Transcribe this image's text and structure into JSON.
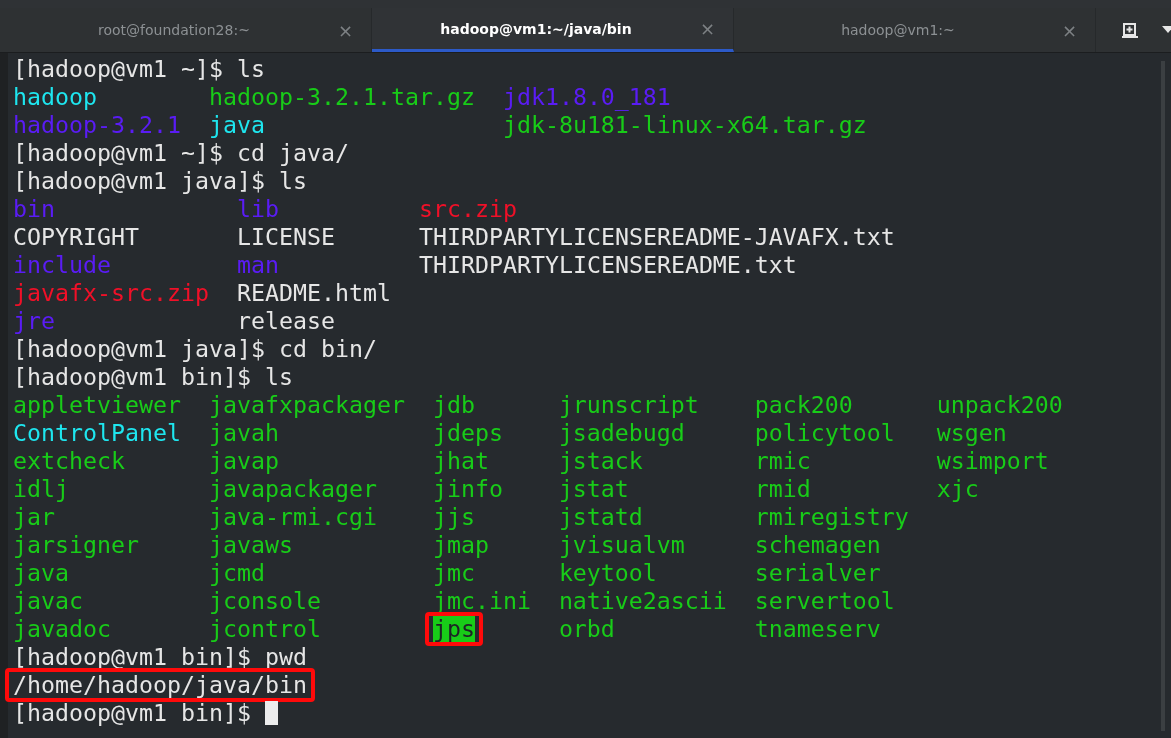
{
  "tabs": [
    {
      "title": "root@foundation28:~",
      "selected": false
    },
    {
      "title": "hadoop@vm1:~/java/bin",
      "selected": true
    },
    {
      "title": "hadoop@vm1:~",
      "selected": false
    }
  ],
  "close_glyph": "×",
  "terminal": {
    "lines": [
      {
        "kind": "command",
        "text": "[hadoop@vm1 ~]$ ls"
      },
      {
        "kind": "listing",
        "columns": [
          [
            {
              "name": "hadoop",
              "color": "#1ee6ef",
              "highlighted": false,
              "boxed": false
            },
            {
              "name": "hadoop-3.2.1",
              "color": "#5a1cf4",
              "highlighted": false,
              "boxed": false
            }
          ],
          [
            {
              "name": "hadoop-3.2.1.tar.gz",
              "color": "#18cc18",
              "highlighted": false,
              "boxed": false
            },
            {
              "name": "java",
              "color": "#1ee6ef",
              "highlighted": false,
              "boxed": false
            }
          ],
          [
            {
              "name": "jdk1.8.0_181",
              "color": "#5a1cf4",
              "highlighted": false,
              "boxed": false
            },
            {
              "name": "jdk-8u181-linux-x64.tar.gz",
              "color": "#18cc18",
              "highlighted": false,
              "boxed": false
            }
          ]
        ]
      },
      {
        "kind": "command",
        "text": "[hadoop@vm1 ~]$ cd java/"
      },
      {
        "kind": "command",
        "text": "[hadoop@vm1 java]$ ls"
      },
      {
        "kind": "listing",
        "columns": [
          [
            {
              "name": "bin",
              "color": "#5a1cf4",
              "highlighted": false,
              "boxed": false
            },
            {
              "name": "COPYRIGHT",
              "color": "#e6e6e6",
              "highlighted": false,
              "boxed": false
            },
            {
              "name": "include",
              "color": "#5a1cf4",
              "highlighted": false,
              "boxed": false
            },
            {
              "name": "javafx-src.zip",
              "color": "#f01028",
              "highlighted": false,
              "boxed": false
            },
            {
              "name": "jre",
              "color": "#5a1cf4",
              "highlighted": false,
              "boxed": false
            }
          ],
          [
            {
              "name": "lib",
              "color": "#5a1cf4",
              "highlighted": false,
              "boxed": false
            },
            {
              "name": "LICENSE",
              "color": "#e6e6e6",
              "highlighted": false,
              "boxed": false
            },
            {
              "name": "man",
              "color": "#5a1cf4",
              "highlighted": false,
              "boxed": false
            },
            {
              "name": "README.html",
              "color": "#e6e6e6",
              "highlighted": false,
              "boxed": false
            },
            {
              "name": "release",
              "color": "#e6e6e6",
              "highlighted": false,
              "boxed": false
            }
          ],
          [
            {
              "name": "src.zip",
              "color": "#f01028",
              "highlighted": false,
              "boxed": false
            },
            {
              "name": "THIRDPARTYLICENSEREADME-JAVAFX.txt",
              "color": "#e6e6e6",
              "highlighted": false,
              "boxed": false
            },
            {
              "name": "THIRDPARTYLICENSEREADME.txt",
              "color": "#e6e6e6",
              "highlighted": false,
              "boxed": false
            }
          ]
        ]
      },
      {
        "kind": "command",
        "text": "[hadoop@vm1 java]$ cd bin/"
      },
      {
        "kind": "command",
        "text": "[hadoop@vm1 bin]$ ls"
      },
      {
        "kind": "listing",
        "columns": [
          [
            {
              "name": "appletviewer",
              "color": "#18cc18",
              "highlighted": false,
              "boxed": false
            },
            {
              "name": "ControlPanel",
              "color": "#1ee6ef",
              "highlighted": false,
              "boxed": false
            },
            {
              "name": "extcheck",
              "color": "#18cc18",
              "highlighted": false,
              "boxed": false
            },
            {
              "name": "idlj",
              "color": "#18cc18",
              "highlighted": false,
              "boxed": false
            },
            {
              "name": "jar",
              "color": "#18cc18",
              "highlighted": false,
              "boxed": false
            },
            {
              "name": "jarsigner",
              "color": "#18cc18",
              "highlighted": false,
              "boxed": false
            },
            {
              "name": "java",
              "color": "#18cc18",
              "highlighted": false,
              "boxed": false
            },
            {
              "name": "javac",
              "color": "#18cc18",
              "highlighted": false,
              "boxed": false
            },
            {
              "name": "javadoc",
              "color": "#18cc18",
              "highlighted": false,
              "boxed": false
            }
          ],
          [
            {
              "name": "javafxpackager",
              "color": "#18cc18",
              "highlighted": false,
              "boxed": false
            },
            {
              "name": "javah",
              "color": "#18cc18",
              "highlighted": false,
              "boxed": false
            },
            {
              "name": "javap",
              "color": "#18cc18",
              "highlighted": false,
              "boxed": false
            },
            {
              "name": "javapackager",
              "color": "#18cc18",
              "highlighted": false,
              "boxed": false
            },
            {
              "name": "java-rmi.cgi",
              "color": "#18cc18",
              "highlighted": false,
              "boxed": false
            },
            {
              "name": "javaws",
              "color": "#18cc18",
              "highlighted": false,
              "boxed": false
            },
            {
              "name": "jcmd",
              "color": "#18cc18",
              "highlighted": false,
              "boxed": false
            },
            {
              "name": "jconsole",
              "color": "#18cc18",
              "highlighted": false,
              "boxed": false
            },
            {
              "name": "jcontrol",
              "color": "#18cc18",
              "highlighted": false,
              "boxed": false
            }
          ],
          [
            {
              "name": "jdb",
              "color": "#18cc18",
              "highlighted": false,
              "boxed": false
            },
            {
              "name": "jdeps",
              "color": "#18cc18",
              "highlighted": false,
              "boxed": false
            },
            {
              "name": "jhat",
              "color": "#18cc18",
              "highlighted": false,
              "boxed": false
            },
            {
              "name": "jinfo",
              "color": "#18cc18",
              "highlighted": false,
              "boxed": false
            },
            {
              "name": "jjs",
              "color": "#18cc18",
              "highlighted": false,
              "boxed": false
            },
            {
              "name": "jmap",
              "color": "#18cc18",
              "highlighted": false,
              "boxed": false
            },
            {
              "name": "jmc",
              "color": "#18cc18",
              "highlighted": false,
              "boxed": false
            },
            {
              "name": "jmc.ini",
              "color": "#18cc18",
              "highlighted": false,
              "boxed": false
            },
            {
              "name": "jps",
              "color": "#18cc18",
              "highlighted": true,
              "boxed": true
            }
          ],
          [
            {
              "name": "jrunscript",
              "color": "#18cc18",
              "highlighted": false,
              "boxed": false
            },
            {
              "name": "jsadebugd",
              "color": "#18cc18",
              "highlighted": false,
              "boxed": false
            },
            {
              "name": "jstack",
              "color": "#18cc18",
              "highlighted": false,
              "boxed": false
            },
            {
              "name": "jstat",
              "color": "#18cc18",
              "highlighted": false,
              "boxed": false
            },
            {
              "name": "jstatd",
              "color": "#18cc18",
              "highlighted": false,
              "boxed": false
            },
            {
              "name": "jvisualvm",
              "color": "#18cc18",
              "highlighted": false,
              "boxed": false
            },
            {
              "name": "keytool",
              "color": "#18cc18",
              "highlighted": false,
              "boxed": false
            },
            {
              "name": "native2ascii",
              "color": "#18cc18",
              "highlighted": false,
              "boxed": false
            },
            {
              "name": "orbd",
              "color": "#18cc18",
              "highlighted": false,
              "boxed": false
            }
          ],
          [
            {
              "name": "pack200",
              "color": "#18cc18",
              "highlighted": false,
              "boxed": false
            },
            {
              "name": "policytool",
              "color": "#18cc18",
              "highlighted": false,
              "boxed": false
            },
            {
              "name": "rmic",
              "color": "#18cc18",
              "highlighted": false,
              "boxed": false
            },
            {
              "name": "rmid",
              "color": "#18cc18",
              "highlighted": false,
              "boxed": false
            },
            {
              "name": "rmiregistry",
              "color": "#18cc18",
              "highlighted": false,
              "boxed": false
            },
            {
              "name": "schemagen",
              "color": "#18cc18",
              "highlighted": false,
              "boxed": false
            },
            {
              "name": "serialver",
              "color": "#18cc18",
              "highlighted": false,
              "boxed": false
            },
            {
              "name": "servertool",
              "color": "#18cc18",
              "highlighted": false,
              "boxed": false
            },
            {
              "name": "tnameserv",
              "color": "#18cc18",
              "highlighted": false,
              "boxed": false
            }
          ],
          [
            {
              "name": "unpack200",
              "color": "#18cc18",
              "highlighted": false,
              "boxed": false
            },
            {
              "name": "wsgen",
              "color": "#18cc18",
              "highlighted": false,
              "boxed": false
            },
            {
              "name": "wsimport",
              "color": "#18cc18",
              "highlighted": false,
              "boxed": false
            },
            {
              "name": "xjc",
              "color": "#18cc18",
              "highlighted": false,
              "boxed": false
            }
          ]
        ]
      },
      {
        "kind": "command",
        "text": "[hadoop@vm1 bin]$ pwd"
      },
      {
        "kind": "output",
        "text": "/home/hadoop/java/bin",
        "boxed": true
      },
      {
        "kind": "command",
        "text": "[hadoop@vm1 bin]$",
        "cursor": true
      }
    ]
  }
}
